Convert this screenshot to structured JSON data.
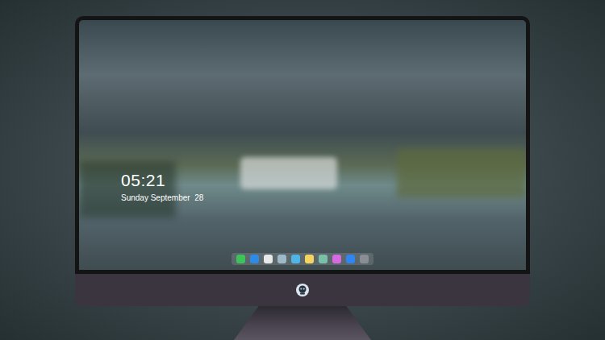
{
  "lock_screen": {
    "time": "05:21",
    "date": "Sunday September  28"
  },
  "dock": {
    "items": [
      {
        "color": "#3cc45a"
      },
      {
        "color": "#2f8ae6"
      },
      {
        "color": "#e8e8e8"
      },
      {
        "color": "#9fb8c8"
      },
      {
        "color": "#4fb4e8"
      },
      {
        "color": "#f4d35e"
      },
      {
        "color": "#7ac0a8"
      },
      {
        "color": "#d66be0"
      },
      {
        "color": "#2f86f0"
      },
      {
        "color": "#8a8d92"
      }
    ]
  }
}
